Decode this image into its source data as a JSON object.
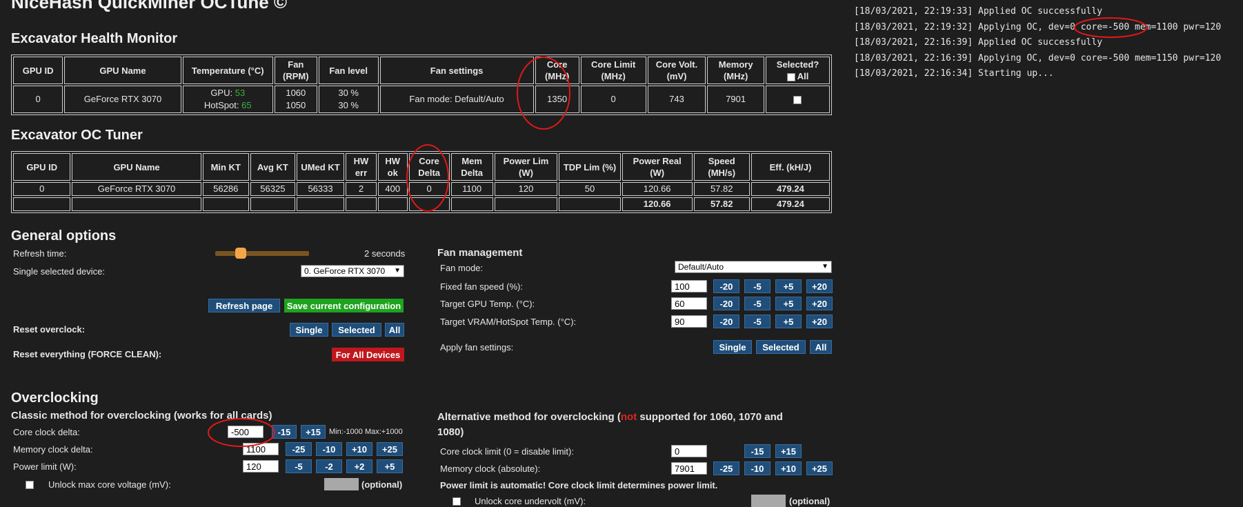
{
  "app_title": "NiceHash QuickMiner OCTune ©",
  "health": {
    "title": "Excavator Health Monitor",
    "headers": [
      "GPU ID",
      "GPU Name",
      "Temperature (°C)",
      "Fan (RPM)",
      "Fan level",
      "Fan settings",
      "Core (MHz)",
      "Core Limit (MHz)",
      "Core Volt. (mV)",
      "Memory (MHz)",
      "Selected?"
    ],
    "all_label": "All",
    "row": {
      "id": "0",
      "name": "GeForce RTX 3070",
      "gpu_label": "GPU: ",
      "gpu_temp": "53",
      "hotspot_label": "HotSpot: ",
      "hotspot_temp": "65",
      "fan_rpm_1": "1060",
      "fan_rpm_2": "1050",
      "fan_level_1": "30 %",
      "fan_level_2": "30 %",
      "fan_settings": "Fan mode: Default/Auto",
      "core": "1350",
      "core_limit": "0",
      "core_volt": "743",
      "memory": "7901"
    }
  },
  "tuner": {
    "title": "Excavator OC Tuner",
    "headers": [
      "GPU ID",
      "GPU Name",
      "Min KT",
      "Avg KT",
      "UMed KT",
      "HW err",
      "HW ok",
      "Core Delta",
      "Mem Delta",
      "Power Lim (W)",
      "TDP Lim (%)",
      "Power Real (W)",
      "Speed (MH/s)",
      "Eff. (kH/J)"
    ],
    "row": [
      "0",
      "GeForce RTX 3070",
      "56286",
      "56325",
      "56333",
      "2",
      "400",
      "0",
      "1100",
      "120",
      "50",
      "120.66",
      "57.82",
      "479.24"
    ],
    "totals": [
      "120.66",
      "57.82",
      "479.24"
    ]
  },
  "general": {
    "title": "General options",
    "refresh_label": "Refresh time:",
    "refresh_value": "2 seconds",
    "refresh_fraction": 0.27,
    "device_label": "Single selected device:",
    "device_value": "0. GeForce RTX 3070",
    "refresh_btn": "Refresh page",
    "save_btn": "Save current configuration",
    "reset_oc_label": "Reset overclock:",
    "reset_all_label": "Reset everything (FORCE CLEAN):",
    "single": "Single",
    "selected": "Selected",
    "all": "All",
    "force_btn": "For All Devices"
  },
  "fan": {
    "title": "Fan management",
    "mode_label": "Fan mode:",
    "mode_value": "Default/Auto",
    "fixed_label": "Fixed fan speed (%):",
    "fixed_value": "100",
    "target_gpu_label": "Target GPU Temp. (°C):",
    "target_gpu_value": "60",
    "target_vram_label": "Target VRAM/HotSpot Temp. (°C):",
    "target_vram_value": "90",
    "apply_label": "Apply fan settings:",
    "steps": [
      "-20",
      "-5",
      "+5",
      "+20"
    ]
  },
  "oc": {
    "title": "Overclocking",
    "classic_title": "Classic method for overclocking (works for all cards)",
    "core_label": "Core clock delta:",
    "core_value": "-500",
    "core_steps": [
      "-15",
      "+15"
    ],
    "core_range": "Min:-1000 Max:+1000",
    "mem_label": "Memory clock delta:",
    "mem_value": "1100",
    "mem_steps": [
      "-25",
      "-10",
      "+10",
      "+25"
    ],
    "power_label": "Power limit (W):",
    "power_value": "120",
    "power_steps": [
      "-5",
      "-2",
      "+2",
      "+5"
    ],
    "unlock_label": "Unlock max core voltage (mV):",
    "optional": "(optional)",
    "alt_title_1": "Alternative method for overclocking (",
    "alt_not": "not",
    "alt_title_2": " supported for 1060, 1070 and",
    "alt_title_3": "1080)",
    "alt_core_label": "Core clock limit (0 = disable limit):",
    "alt_core_value": "0",
    "alt_core_steps": [
      "-15",
      "+15"
    ],
    "alt_mem_label": "Memory clock (absolute):",
    "alt_mem_value": "7901",
    "alt_mem_steps": [
      "-25",
      "-10",
      "+10",
      "+25"
    ],
    "power_note": "Power limit is automatic! Core clock limit determines power limit.",
    "undervolt_label": "Unlock core undervolt (mV):"
  },
  "log": [
    "[18/03/2021, 22:19:33] Applied OC successfully",
    "[18/03/2021, 22:19:32] Applying OC, dev=0 core=-500 mem=1100 pwr=120",
    "[18/03/2021, 22:16:39] Applied OC successfully",
    "[18/03/2021, 22:16:39] Applying OC, dev=0 core=-500 mem=1150 pwr=120",
    "[18/03/2021, 22:16:34] Starting up..."
  ]
}
